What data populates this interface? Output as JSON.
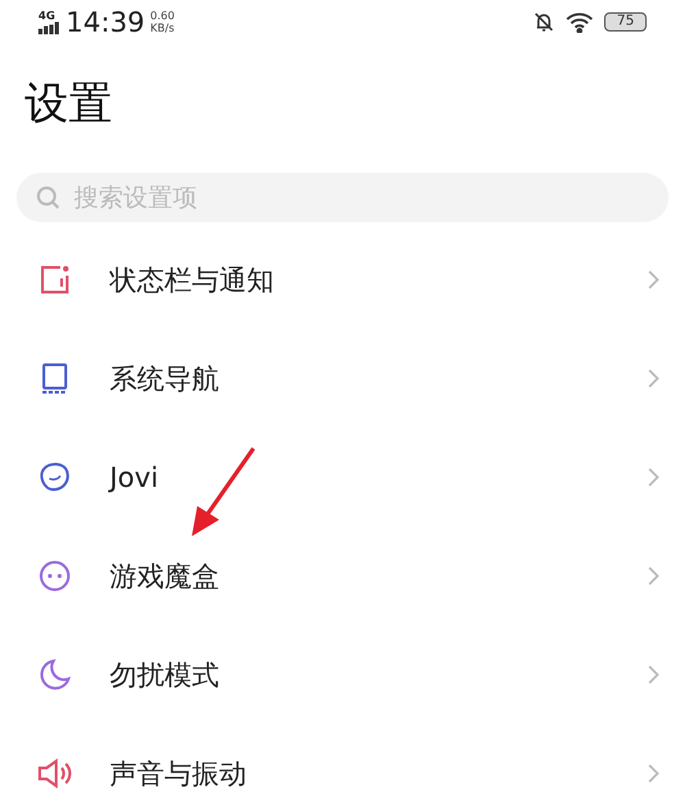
{
  "status_bar": {
    "network": "4G",
    "time": "14:39",
    "speed_value": "0.60",
    "speed_unit": "KB/s",
    "battery": "75"
  },
  "title": "设置",
  "search": {
    "placeholder": "搜索设置项"
  },
  "items": [
    {
      "kind": "status-bar",
      "label": "状态栏与通知",
      "color": "#e0506a"
    },
    {
      "kind": "navigation",
      "label": "系统导航",
      "color": "#4a5fd0"
    },
    {
      "kind": "assistant",
      "label": "Jovi",
      "color": "#4a5fd0"
    },
    {
      "kind": "game",
      "label": "游戏魔盒",
      "color": "#9a6ae0"
    },
    {
      "kind": "moon",
      "label": "勿扰模式",
      "color": "#9a6ae0"
    },
    {
      "kind": "sound",
      "label": "声音与振动",
      "color": "#e0506a"
    }
  ]
}
